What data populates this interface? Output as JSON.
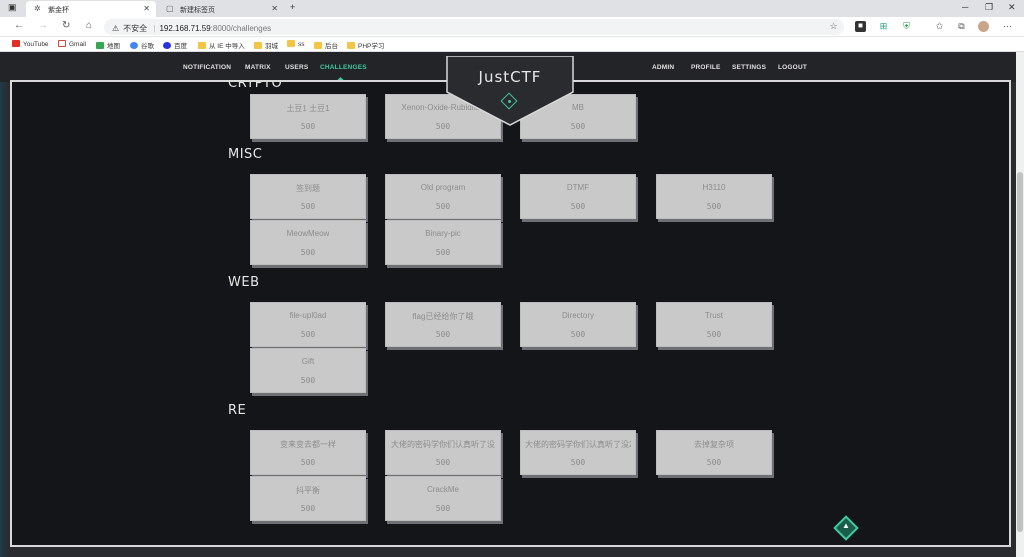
{
  "browser": {
    "tabs": [
      {
        "title": "紫金杯",
        "active": true
      },
      {
        "title": "新建标签页",
        "active": false
      }
    ],
    "security_label": "不安全",
    "url_host": "192.168.71.59",
    "url_path": ":8000/challenges",
    "bookmarks": [
      "YouTube",
      "Gmail",
      "地图",
      "谷歌",
      "百度",
      "从 IE 中导入",
      "羽城",
      "ss",
      "后台",
      "PHP学习"
    ]
  },
  "nav": {
    "left": [
      "NOTIFICATION",
      "MATRIX",
      "USERS",
      "CHALLENGES"
    ],
    "right": [
      "ADMIN",
      "PROFILE",
      "SETTINGS",
      "LOGOUT"
    ],
    "active": "CHALLENGES",
    "logo": "JustCTF"
  },
  "colors": {
    "accent": "#3ec9a0",
    "card": "#c9c9c9",
    "background": "#141518"
  },
  "sections": [
    {
      "title": "CRYPTO",
      "cards": [
        {
          "name": "土豆1 土豆1",
          "points": "500"
        },
        {
          "name": "Xenon-Oxide-Rubidium",
          "points": "500"
        },
        {
          "name": "MB",
          "points": "500"
        }
      ]
    },
    {
      "title": "MISC",
      "cards": [
        {
          "name": "签到题",
          "points": "500"
        },
        {
          "name": "Old program",
          "points": "500"
        },
        {
          "name": "DTMF",
          "points": "500"
        },
        {
          "name": "H3110",
          "points": "500"
        },
        {
          "name": "MeowMeow",
          "points": "500"
        },
        {
          "name": "Binary-pic",
          "points": "500"
        }
      ]
    },
    {
      "title": "WEB",
      "cards": [
        {
          "name": "file-upl0ad",
          "points": "500"
        },
        {
          "name": "flag已经给你了哦",
          "points": "500"
        },
        {
          "name": "Directory",
          "points": "500"
        },
        {
          "name": "Trust",
          "points": "500"
        },
        {
          "name": "Gift",
          "points": "500"
        }
      ]
    },
    {
      "title": "RE",
      "cards": [
        {
          "name": "变来变去都一样",
          "points": "500"
        },
        {
          "name": "大佬的密码学你们认真听了没",
          "points": "500"
        },
        {
          "name": "大佬的密码学你们认真听了没2",
          "points": "500"
        },
        {
          "name": "去掉复杂项",
          "points": "500"
        },
        {
          "name": "抖平衡",
          "points": "500"
        },
        {
          "name": "CrackMe",
          "points": "500"
        }
      ]
    }
  ]
}
